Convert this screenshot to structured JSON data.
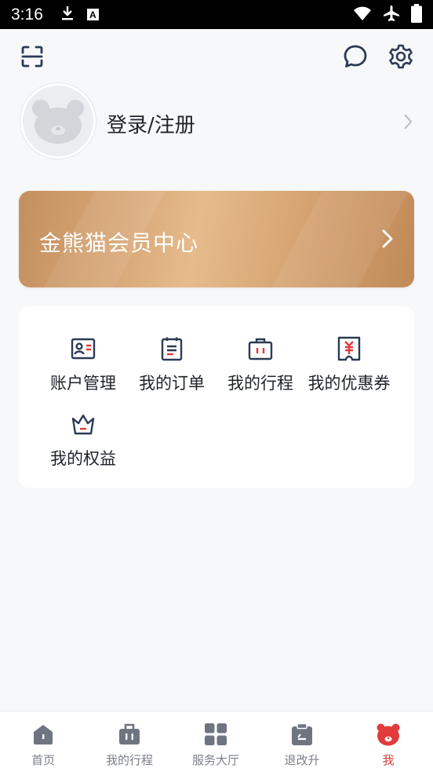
{
  "status_bar": {
    "time": "3:16"
  },
  "profile": {
    "login_label": "登录/注册"
  },
  "vip": {
    "title": "金熊猫会员中心"
  },
  "menu": {
    "items": [
      {
        "label": "账户管理",
        "icon": "id-card-icon"
      },
      {
        "label": "我的订单",
        "icon": "order-list-icon"
      },
      {
        "label": "我的行程",
        "icon": "luggage-icon"
      },
      {
        "label": "我的优惠券",
        "icon": "coupon-icon"
      },
      {
        "label": "我的权益",
        "icon": "crown-icon"
      }
    ]
  },
  "bottom_nav": {
    "items": [
      {
        "label": "首页",
        "icon": "home-icon",
        "active": false
      },
      {
        "label": "我的行程",
        "icon": "luggage-icon",
        "active": false
      },
      {
        "label": "服务大厅",
        "icon": "grid-icon",
        "active": false
      },
      {
        "label": "退改升",
        "icon": "clipboard-icon",
        "active": false
      },
      {
        "label": "我",
        "icon": "panda-icon",
        "active": true
      }
    ]
  },
  "colors": {
    "accent": "#e23b3b",
    "gold": "#d9a877",
    "icon_dark": "#2b3a55"
  }
}
